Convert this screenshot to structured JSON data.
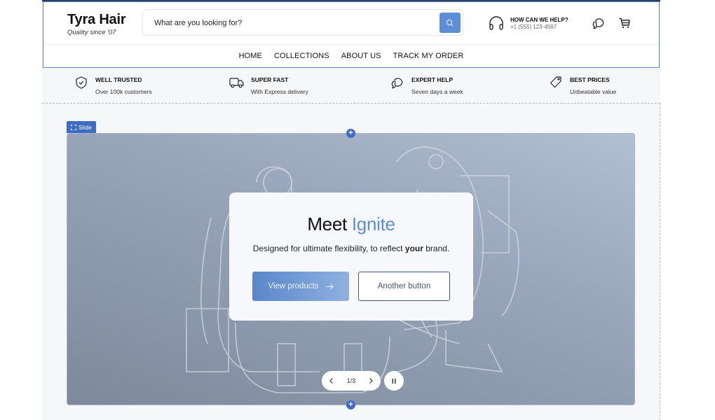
{
  "brand": {
    "name": "Tyra Hair",
    "tagline": "Quality since '07"
  },
  "search": {
    "placeholder": "What are you looking for?",
    "value": "",
    "button_icon": "search-icon"
  },
  "help": {
    "title": "HOW CAN WE HELP?",
    "phone": "+1 (555) 123-4567",
    "icon": "headphones-icon"
  },
  "header_icons": [
    "chat-icon",
    "cart-icon"
  ],
  "nav": {
    "items": [
      {
        "label": "HOME"
      },
      {
        "label": "COLLECTIONS"
      },
      {
        "label": "ABOUT US"
      },
      {
        "label": "TRACK MY ORDER"
      }
    ]
  },
  "features": [
    {
      "icon": "shield-check-icon",
      "title": "WELL TRUSTED",
      "subtitle": "Over 100k customers"
    },
    {
      "icon": "truck-icon",
      "title": "SUPER FAST",
      "subtitle": "With Express delivery"
    },
    {
      "icon": "chat-bubbles-icon",
      "title": "EXPERT HELP",
      "subtitle": "Seven days a week"
    },
    {
      "icon": "tag-icon",
      "title": "BEST PRICES",
      "subtitle": "Unbeatable value"
    }
  ],
  "editor": {
    "slide_badge": "Slide",
    "add_label": "+"
  },
  "slide": {
    "title_main": "Meet",
    "title_accent": "Ignite",
    "desc_before": "Designed for ultimate flexibility, to reflect ",
    "desc_bold": "your",
    "desc_after": " brand.",
    "primary_button": "View products",
    "secondary_button": "Another button",
    "pager": "1/3",
    "colors": {
      "accent": "#5f8fcc",
      "editor_blue": "#3d6cc5"
    }
  }
}
